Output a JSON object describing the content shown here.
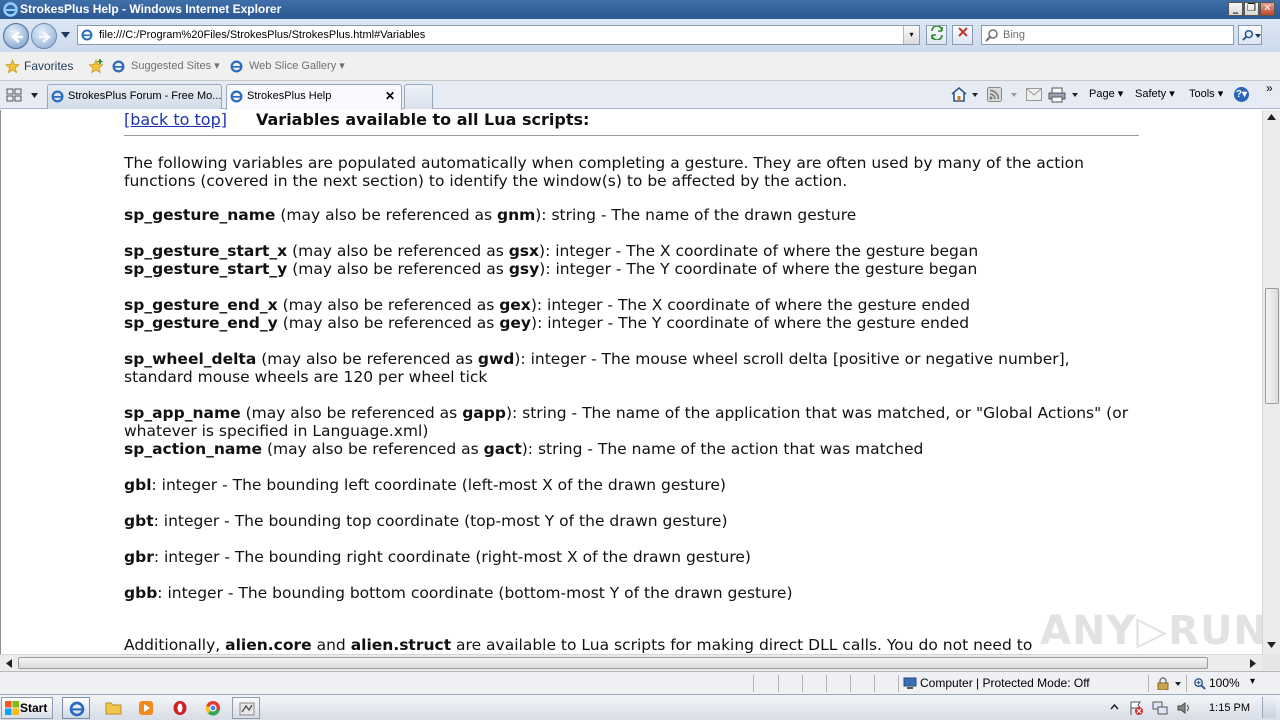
{
  "window": {
    "title": "StrokesPlus Help - Windows Internet Explorer",
    "min_label": "_",
    "max_label": "❐",
    "close_label": "✕"
  },
  "address": {
    "url": "file:///C:/Program%20Files/StrokesPlus/StrokesPlus.html#Variables",
    "dropdown_label": "▾"
  },
  "search": {
    "placeholder": "Bing"
  },
  "favorites": {
    "label": "Favorites",
    "items": [
      {
        "label": "Suggested Sites ▾"
      },
      {
        "label": "Web Slice Gallery ▾"
      }
    ]
  },
  "tabs": [
    {
      "label": "StrokesPlus Forum - Free Mo...",
      "active": false
    },
    {
      "label": "StrokesPlus Help",
      "active": true
    }
  ],
  "tab_close": "✕",
  "commandbar": {
    "page": "Page ▾",
    "safety": "Safety ▾",
    "tools": "Tools ▾",
    "help": "?▾"
  },
  "content": {
    "back_to_top": "[back to top]",
    "heading": "Variables available to all Lua scripts:",
    "intro": "The following variables are populated automatically when completing a gesture. They are often used by many of the action functions (covered in the next section) to identify the window(s) to be affected by the action.",
    "vars": [
      {
        "name": "sp_gesture_name",
        "mid": " (may also be referenced as ",
        "alias": "gnm",
        "desc": "): string - The name of the drawn gesture"
      },
      {
        "name": "sp_gesture_start_x",
        "mid": " (may also be referenced as ",
        "alias": "gsx",
        "desc": "): integer - The X coordinate of where the gesture began"
      },
      {
        "name": "sp_gesture_start_y",
        "mid": " (may also be referenced as ",
        "alias": "gsy",
        "desc": "): integer - The Y coordinate of where the gesture began"
      },
      {
        "name": "sp_gesture_end_x",
        "mid": " (may also be referenced as ",
        "alias": "gex",
        "desc": "): integer - The X coordinate of where the gesture ended"
      },
      {
        "name": "sp_gesture_end_y",
        "mid": " (may also be referenced as ",
        "alias": "gey",
        "desc": "): integer - The Y coordinate of where the gesture ended"
      },
      {
        "name": "sp_wheel_delta",
        "mid": " (may also be referenced as ",
        "alias": "gwd",
        "desc": "): integer - The mouse wheel scroll delta [positive or negative number], standard mouse wheels are 120 per wheel tick"
      },
      {
        "name": "sp_app_name",
        "mid": " (may also be referenced as ",
        "alias": "gapp",
        "desc": "): string - The name of the application that was matched, or \"Global Actions\" (or whatever is specified in Language.xml)"
      },
      {
        "name": "sp_action_name",
        "mid": " (may also be referenced as ",
        "alias": "gact",
        "desc": "): string - The name of the action that was matched"
      },
      {
        "name": "gbl",
        "mid": "",
        "alias": "",
        "desc": ": integer - The bounding left coordinate (left-most X of the drawn gesture)"
      },
      {
        "name": "gbt",
        "mid": "",
        "alias": "",
        "desc": ": integer - The bounding top coordinate (top-most Y of the drawn gesture)"
      },
      {
        "name": "gbr",
        "mid": "",
        "alias": "",
        "desc": ": integer - The bounding right coordinate (right-most X of the drawn gesture)"
      },
      {
        "name": "gbb",
        "mid": "",
        "alias": "",
        "desc": ": integer - The bounding bottom coordinate (bottom-most Y of the drawn gesture)"
      }
    ],
    "footer": {
      "pre": "Additionally, ",
      "b1": "alien.core",
      "and": " and ",
      "b2": "alien.struct",
      "post": " are available to Lua scripts for making direct DLL calls. You do not need to"
    }
  },
  "statusbar": {
    "zone": "Computer | Protected Mode: Off",
    "zoom": "100%",
    "zoom_drop": "▾"
  },
  "taskbar": {
    "start": "Start",
    "clock": "1:15 PM"
  },
  "watermark": "ANY▷RUN",
  "colors": {
    "link": "#1c33b4",
    "titlebar": "#2b5891"
  }
}
